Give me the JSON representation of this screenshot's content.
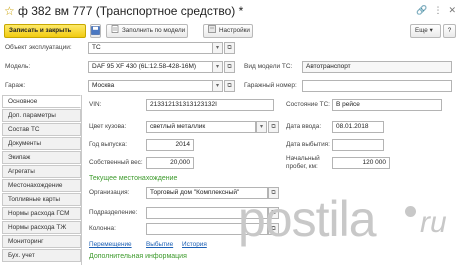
{
  "titlebar": {
    "title": "ф 382 вм 777  (Транспортное средство) *"
  },
  "toolbar": {
    "save_close": "Записать и закрыть",
    "fill_model": "Заполнить по модели",
    "settings": "Настройки",
    "more": "Еще",
    "help": "?"
  },
  "header": {
    "object_label": "Объект эксплуатации:",
    "object_value": "ТС",
    "model_label": "Модель:",
    "model_value": "DAF 95 XF 430 (6L:12.58-428-16M)",
    "model_type_label": "Вид модели ТС:",
    "model_type_value": "Автотранспорт",
    "garage_label": "Гараж:",
    "garage_value": "Москва",
    "garage_number_label": "Гаражный номер:",
    "garage_number_value": ""
  },
  "tabs": [
    "Основное",
    "Доп. параметры",
    "Состав ТС",
    "Документы",
    "Экипаж",
    "Агрегаты",
    "Местонахождение",
    "Топливные карты",
    "Нормы расхода ГСМ",
    "Нормы расхода ТЖ",
    "Мониторинг",
    "Бух. учет"
  ],
  "main": {
    "vin_label": "VIN:",
    "vin_value": "213312131313123132I",
    "color_label": "Цвет кузова:",
    "color_value": "светлый металлик",
    "year_label": "Год выпуска:",
    "year_value": "2014",
    "weight_label": "Собственный вес:",
    "weight_value": "20,000",
    "status_label": "Состояние ТС:",
    "status_value": "В рейсе",
    "date_in_label": "Дата ввода:",
    "date_in_value": "08.01.2018",
    "date_out_label": "Дата выбытия:",
    "date_out_value": "",
    "mileage_label_1": "Начальный",
    "mileage_label_2": "пробег, км:",
    "mileage_value": "120 000",
    "location_section": "Текущее местонахождение",
    "org_label": "Организация:",
    "org_value": "Торговый дом \"Комплексный\"",
    "dept_label": "Подразделение:",
    "dept_value": "",
    "column_label": "Колонна:",
    "column_value": "",
    "link_move": "Перемещение",
    "link_dispose": "Выбытие",
    "link_history": "История",
    "extra_section": "Дополнительная информация"
  },
  "watermark": {
    "text": "postila",
    "suffix": "ru"
  },
  "colors": {
    "accent_yellow": "#f2cb10",
    "link_blue": "#1b5fb4",
    "section_green": "#3d9a2c"
  }
}
